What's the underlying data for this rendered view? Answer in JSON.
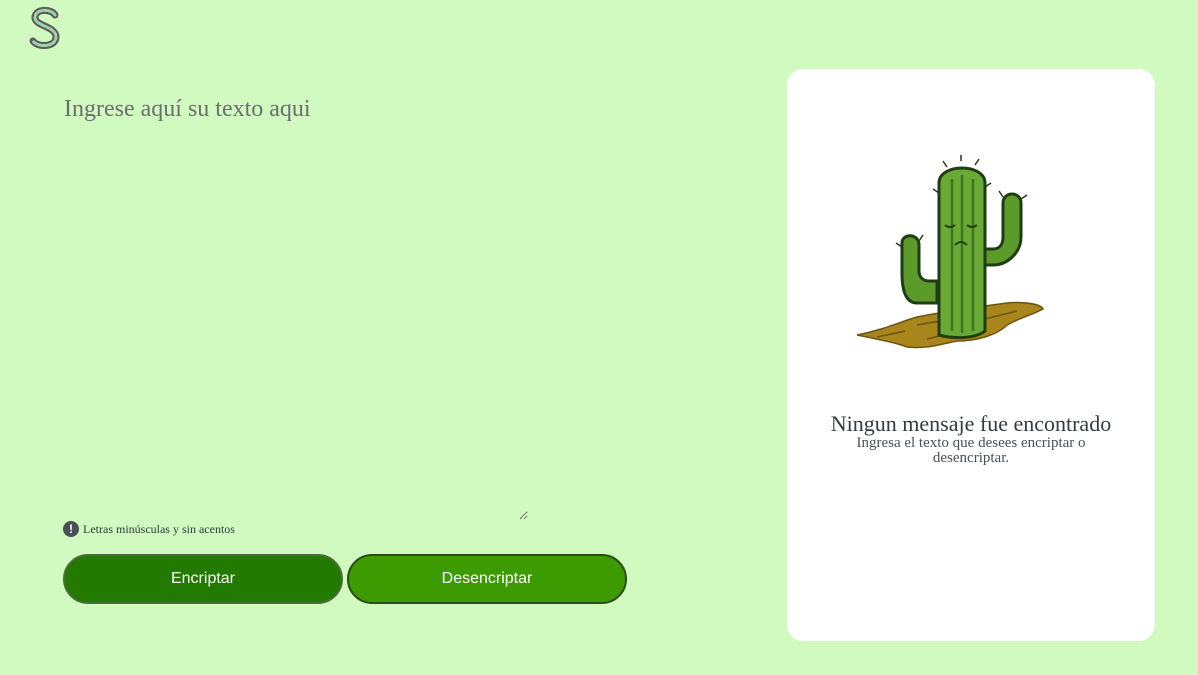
{
  "logo": {
    "letter": "S"
  },
  "input": {
    "placeholder": "Ingrese aquí su texto aqui",
    "value": ""
  },
  "hint": {
    "text": "Letras minúsculas y sin acentos",
    "icon": "exclamation-circle-icon"
  },
  "buttons": {
    "encrypt_label": "Encriptar",
    "decrypt_label": "Desencriptar"
  },
  "output": {
    "title": "Ningun mensaje fue encontrado",
    "subtitle": "Ingresa el texto que desees encriptar o desencriptar.",
    "illustration": "sad-cactus"
  },
  "colors": {
    "background": "#d0fac0",
    "encrypt_button": "#237a00",
    "decrypt_button": "#3d9a00",
    "panel": "#ffffff"
  }
}
